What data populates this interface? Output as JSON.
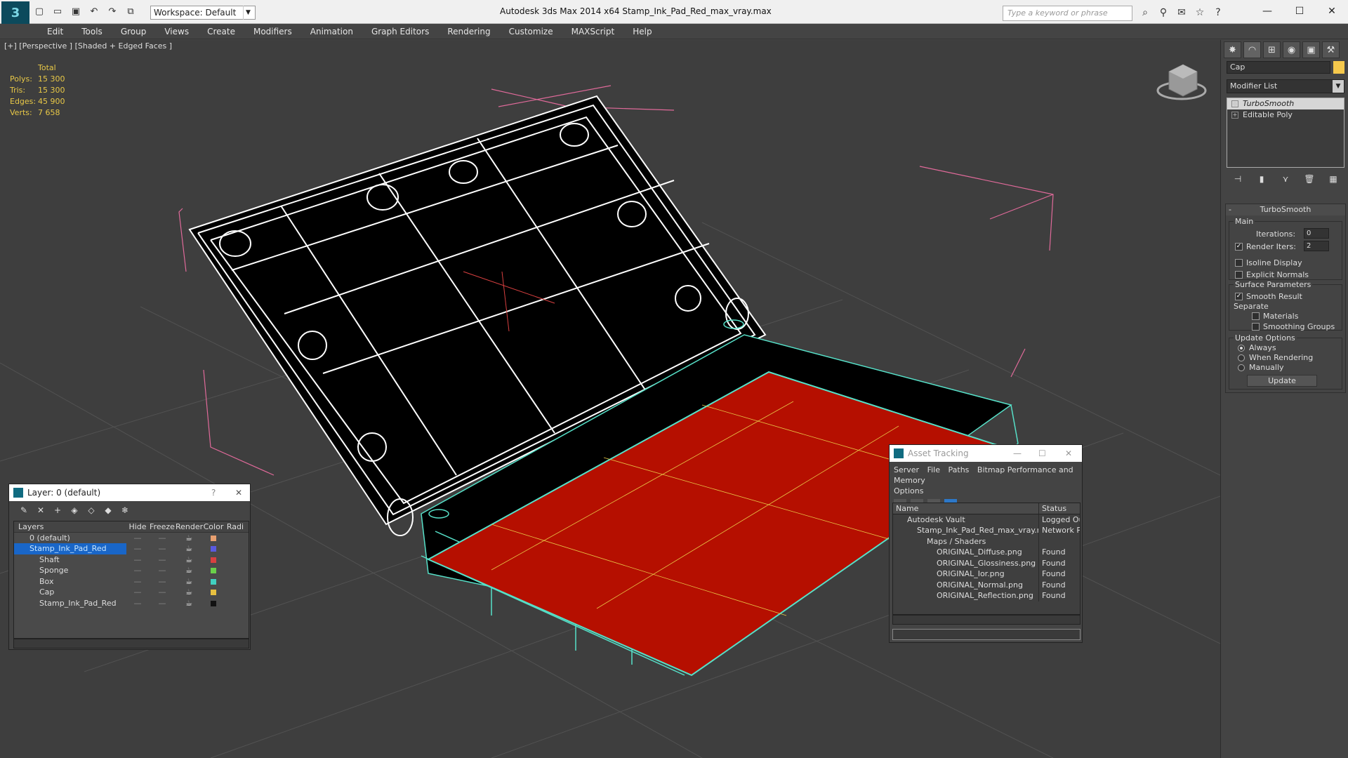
{
  "titlebar": {
    "app_logo": "3",
    "workspace": "Workspace: Default",
    "title": "Autodesk 3ds Max  2014 x64      Stamp_Ink_Pad_Red_max_vray.max",
    "search_placeholder": "Type a keyword or phrase"
  },
  "menu": [
    "Edit",
    "Tools",
    "Group",
    "Views",
    "Create",
    "Modifiers",
    "Animation",
    "Graph Editors",
    "Rendering",
    "Customize",
    "MAXScript",
    "Help"
  ],
  "viewport": {
    "label": "[+] [Perspective ] [Shaded + Edged Faces ]",
    "stats": {
      "header": "Total",
      "rows": [
        {
          "k": "Polys:",
          "v": "15 300"
        },
        {
          "k": "Tris:",
          "v": "15 300"
        },
        {
          "k": "Edges:",
          "v": "45 900"
        },
        {
          "k": "Verts:",
          "v": "7 658"
        }
      ]
    }
  },
  "command_panel": {
    "object_name": "Cap",
    "object_color": "#f5c84c",
    "modifier_list": "Modifier List",
    "stack": [
      "TurboSmooth",
      "Editable Poly"
    ],
    "rollout": {
      "title": "TurboSmooth",
      "main_label": "Main",
      "iterations_label": "Iterations:",
      "iterations": "0",
      "render_iters_label": "Render Iters:",
      "render_iters": "2",
      "isoline": "Isoline Display",
      "explicit": "Explicit Normals",
      "surface_label": "Surface Parameters",
      "smooth_result": "Smooth Result",
      "separate": "Separate",
      "materials": "Materials",
      "smoothing_groups": "Smoothing Groups",
      "update_label": "Update Options",
      "always": "Always",
      "when_rendering": "When Rendering",
      "manually": "Manually",
      "update_btn": "Update"
    }
  },
  "layer_window": {
    "title": "Layer: 0 (default)",
    "help": "?",
    "columns": [
      "Layers",
      "Hide",
      "Freeze",
      "Render",
      "Color",
      "Radi"
    ],
    "rows": [
      {
        "name": "0 (default)",
        "color": "#e8a070"
      },
      {
        "name": "Stamp_Ink_Pad_Red",
        "color": "#5a5ae0"
      },
      {
        "name": "Shaft",
        "color": "#d94040"
      },
      {
        "name": "Sponge",
        "color": "#6ad04a"
      },
      {
        "name": "Box",
        "color": "#40d0c0"
      },
      {
        "name": "Cap",
        "color": "#e8c040"
      },
      {
        "name": "Stamp_Ink_Pad_Red",
        "color": "#111111"
      }
    ]
  },
  "asset_window": {
    "title": "Asset Tracking",
    "menu": [
      "Server",
      "File",
      "Paths",
      "Bitmap Performance and Memory",
      "Options"
    ],
    "columns": [
      "Name",
      "Status"
    ],
    "rows": [
      {
        "name": "Autodesk Vault",
        "status": "Logged Out"
      },
      {
        "name": "Stamp_Ink_Pad_Red_max_vray.max",
        "status": "Network Pat"
      },
      {
        "name": "Maps / Shaders",
        "status": ""
      },
      {
        "name": "ORIGINAL_Diffuse.png",
        "status": "Found"
      },
      {
        "name": "ORIGINAL_Glossiness.png",
        "status": "Found"
      },
      {
        "name": "ORIGINAL_Ior.png",
        "status": "Found"
      },
      {
        "name": "ORIGINAL_Normal.png",
        "status": "Found"
      },
      {
        "name": "ORIGINAL_Reflection.png",
        "status": "Found"
      }
    ]
  },
  "colors": {
    "viewport_bg": "#3e3e3e",
    "pad_red": "#b50f00",
    "wire_white": "#ffffff",
    "wire_cyan": "#56e0c8",
    "bbox_pink": "#e06a9a",
    "stats_yellow": "#e8c847"
  }
}
